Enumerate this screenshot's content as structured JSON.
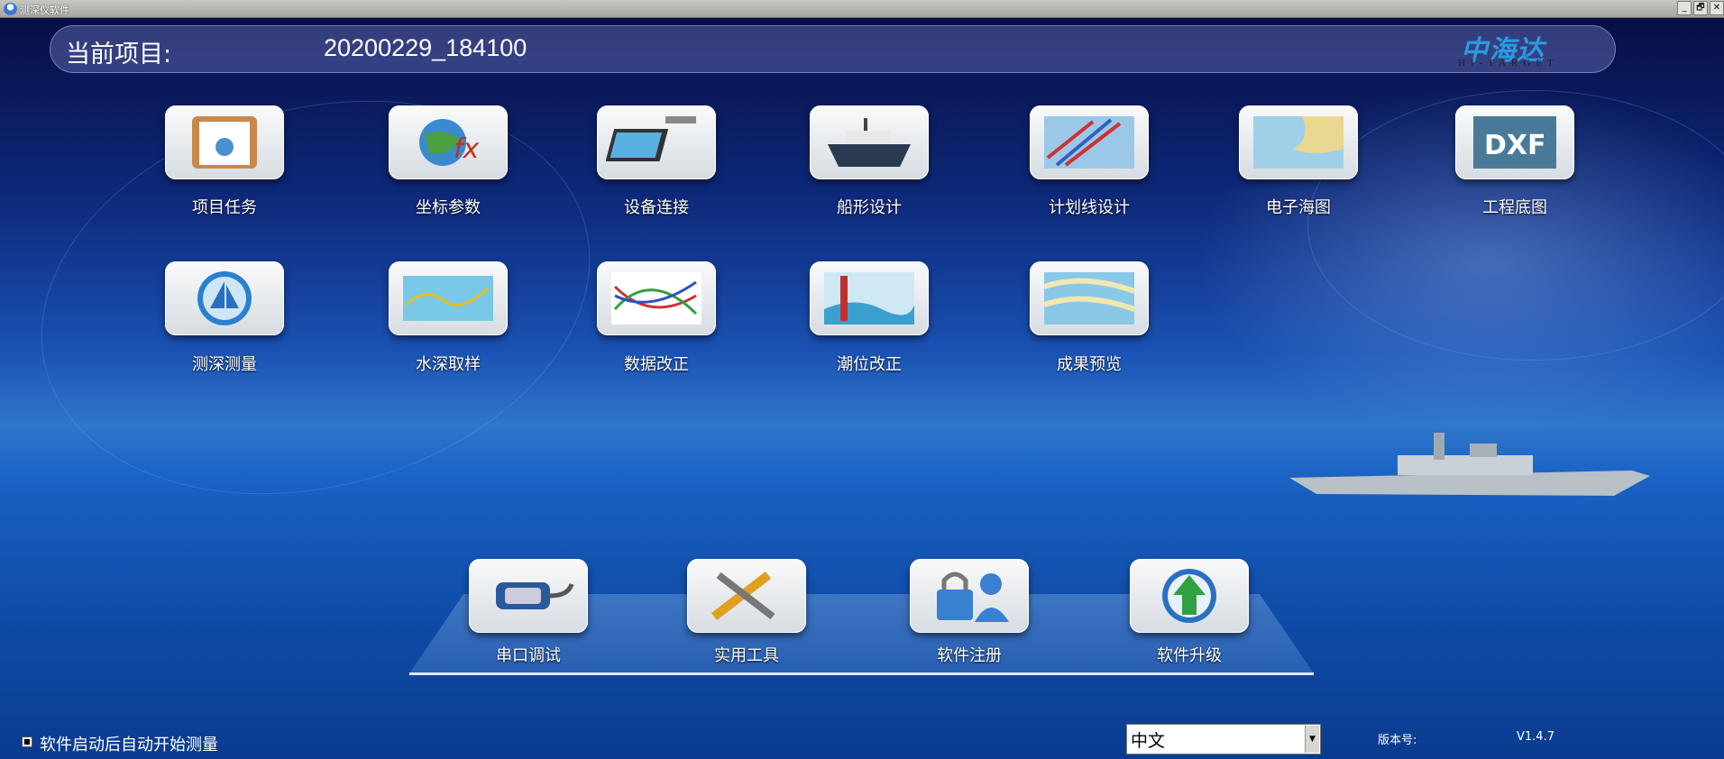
{
  "window": {
    "title": "测深仪软件",
    "minimize": "_",
    "restore": "🗗",
    "close": "✕"
  },
  "header": {
    "label": "当前项目:",
    "project": "20200229_184100",
    "logo_cn": "中海达",
    "logo_en": "HI-TARGET"
  },
  "modules": [
    {
      "label": "项目任务",
      "icon": "clipboard-user-icon"
    },
    {
      "label": "坐标参数",
      "icon": "globe-fx-icon"
    },
    {
      "label": "设备连接",
      "icon": "laptop-gnss-icon"
    },
    {
      "label": "船形设计",
      "icon": "ship-icon"
    },
    {
      "label": "计划线设计",
      "icon": "survey-lines-icon"
    },
    {
      "label": "电子海图",
      "icon": "chart-map-icon"
    },
    {
      "label": "工程底图",
      "icon": "dxf-icon"
    },
    {
      "label": "测深测量",
      "icon": "sailboat-icon"
    },
    {
      "label": "水深取样",
      "icon": "depth-sample-icon"
    },
    {
      "label": "数据改正",
      "icon": "data-correct-icon"
    },
    {
      "label": "潮位改正",
      "icon": "tide-correct-icon"
    },
    {
      "label": "成果预览",
      "icon": "result-preview-icon"
    }
  ],
  "tools": [
    {
      "label": "串口调试",
      "icon": "serial-port-icon"
    },
    {
      "label": "实用工具",
      "icon": "tools-icon"
    },
    {
      "label": "软件注册",
      "icon": "lock-user-icon"
    },
    {
      "label": "软件升级",
      "icon": "upgrade-arrow-icon"
    }
  ],
  "footer": {
    "autostart_label": "软件启动后自动开始测量",
    "autostart_checked": true,
    "language": "中文",
    "version_label": "版本号:",
    "version": "V1.4.7"
  }
}
